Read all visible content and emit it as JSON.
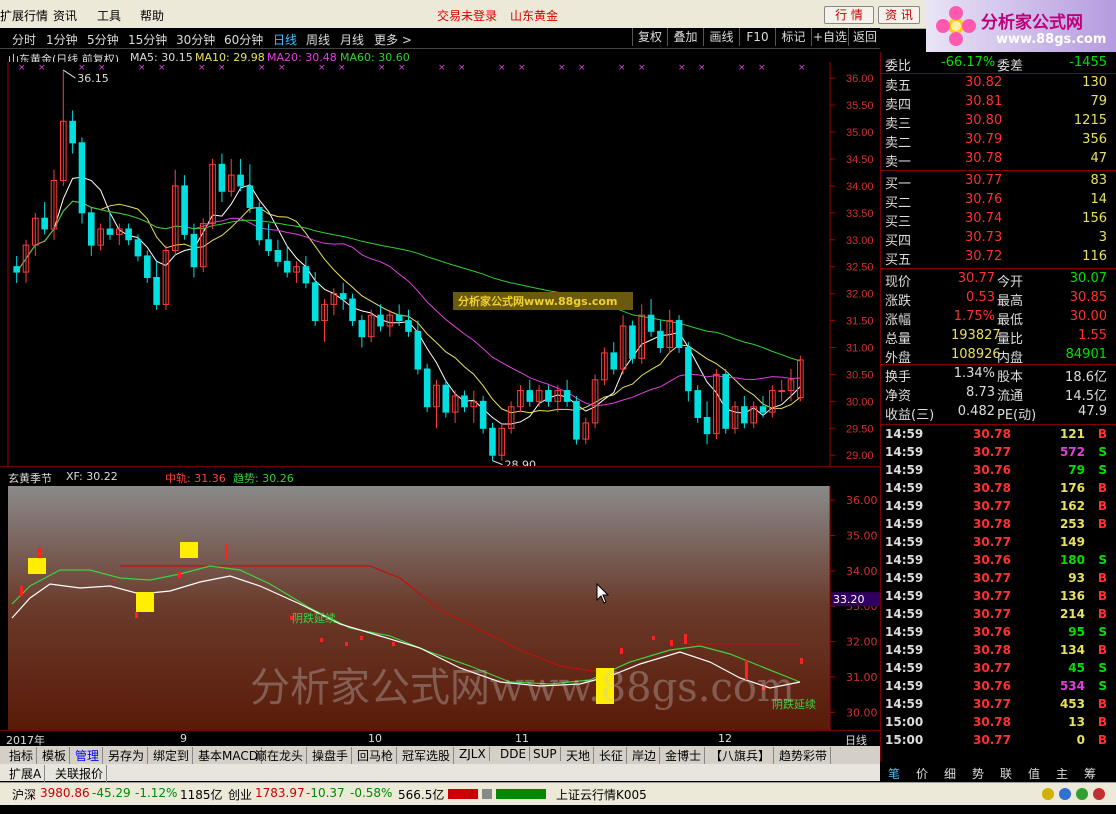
{
  "menu": {
    "items": [
      "扩展行情",
      "资讯",
      "工具",
      "帮助"
    ],
    "status1": "交易未登录",
    "status2": "山东黄金",
    "btn_quote": "行 情",
    "btn_info": "资 讯"
  },
  "logo": {
    "title": "分析家公式网",
    "url": "www.88gs.com"
  },
  "periods": [
    "分时",
    "1分钟",
    "5分钟",
    "15分钟",
    "30分钟",
    "60分钟",
    "日线",
    "周线",
    "月线",
    "更多 >"
  ],
  "active_period": "日线",
  "toolbar": [
    "复权",
    "叠加",
    "画线",
    "F10",
    "标记",
    "+自选",
    "返回"
  ],
  "legend": {
    "name": "山东黄金(日线 前复权)",
    "ma5": "MA5: 30.15",
    "ma10": "MA10: 29.98",
    "ma20": "MA20: 30.48",
    "ma60": "MA60: 30.60",
    "high_label": "36.15",
    "low_label": "28.90",
    "watermark_box": "分析家公式网www.88gs.com"
  },
  "indicator": {
    "name": "玄黄季节",
    "xf": "XF: 30.22",
    "zg": "中轨: 31.36",
    "qs": "趋势: 30.26",
    "text1": "阴跌延续",
    "text2": "阴跌延续",
    "watermark": "分析家公式网www.88gs.com",
    "price_tag": "33.20"
  },
  "colors": {
    "up": "#ff3c3c",
    "down": "#00e0e0",
    "ma5": "#ffffff",
    "ma10": "#e8e060",
    "ma20": "#e040e0",
    "ma60": "#30d030",
    "accent": "#ff4040"
  },
  "price_axis": [
    "36.00",
    "35.50",
    "35.00",
    "34.50",
    "34.00",
    "33.50",
    "33.00",
    "32.50",
    "32.00",
    "31.50",
    "31.00",
    "30.50",
    "30.00",
    "29.50",
    "29.00"
  ],
  "ind_axis": [
    "36.00",
    "35.00",
    "34.00",
    "33.00",
    "32.00",
    "31.00",
    "30.00"
  ],
  "time_axis": [
    "2017年",
    "9",
    "10",
    "11",
    "12"
  ],
  "time_axis_right": "日线",
  "quote": {
    "wb_label": "委比",
    "wb_val": "-66.17%",
    "wc_label": "委差",
    "wc_val": "-1455",
    "sells": [
      {
        "l": "卖五",
        "p": "30.82",
        "v": "130"
      },
      {
        "l": "卖四",
        "p": "30.81",
        "v": "79"
      },
      {
        "l": "卖三",
        "p": "30.80",
        "v": "1215"
      },
      {
        "l": "卖二",
        "p": "30.79",
        "v": "356"
      },
      {
        "l": "卖一",
        "p": "30.78",
        "v": "47"
      }
    ],
    "buys": [
      {
        "l": "买一",
        "p": "30.77",
        "v": "83"
      },
      {
        "l": "买二",
        "p": "30.76",
        "v": "14"
      },
      {
        "l": "买三",
        "p": "30.74",
        "v": "156"
      },
      {
        "l": "买四",
        "p": "30.73",
        "v": "3"
      },
      {
        "l": "买五",
        "p": "30.72",
        "v": "116"
      }
    ],
    "stats": [
      {
        "l1": "现价",
        "v1": "30.77",
        "l2": "今开",
        "v2": "30.07"
      },
      {
        "l1": "涨跌",
        "v1": "0.53",
        "l2": "最高",
        "v2": "30.85"
      },
      {
        "l1": "涨幅",
        "v1": "1.75%",
        "l2": "最低",
        "v2": "30.00"
      },
      {
        "l1": "总量",
        "v1": "193827",
        "l2": "量比",
        "v2": "1.55"
      },
      {
        "l1": "外盘",
        "v1": "108926",
        "l2": "内盘",
        "v2": "84901"
      },
      {
        "l1": "换手",
        "v1": "1.34%",
        "l2": "股本",
        "v2": "18.6亿"
      },
      {
        "l1": "净资",
        "v1": "8.73",
        "l2": "流通",
        "v2": "14.5亿"
      },
      {
        "l1": "收益(三)",
        "v1": "0.482",
        "l2": "PE(动)",
        "v2": "47.9"
      }
    ],
    "ticks": [
      {
        "t": "14:59",
        "p": "30.78",
        "v": "121",
        "s": "B"
      },
      {
        "t": "14:59",
        "p": "30.77",
        "v": "572",
        "s": "S"
      },
      {
        "t": "14:59",
        "p": "30.76",
        "v": "79",
        "s": "S"
      },
      {
        "t": "14:59",
        "p": "30.78",
        "v": "176",
        "s": "B"
      },
      {
        "t": "14:59",
        "p": "30.77",
        "v": "162",
        "s": "B"
      },
      {
        "t": "14:59",
        "p": "30.78",
        "v": "253",
        "s": "B"
      },
      {
        "t": "14:59",
        "p": "30.77",
        "v": "149",
        "s": ""
      },
      {
        "t": "14:59",
        "p": "30.76",
        "v": "180",
        "s": "S"
      },
      {
        "t": "14:59",
        "p": "30.77",
        "v": "93",
        "s": "B"
      },
      {
        "t": "14:59",
        "p": "30.77",
        "v": "136",
        "s": "B"
      },
      {
        "t": "14:59",
        "p": "30.77",
        "v": "214",
        "s": "B"
      },
      {
        "t": "14:59",
        "p": "30.76",
        "v": "95",
        "s": "S"
      },
      {
        "t": "14:59",
        "p": "30.78",
        "v": "134",
        "s": "B"
      },
      {
        "t": "14:59",
        "p": "30.77",
        "v": "45",
        "s": "S"
      },
      {
        "t": "14:59",
        "p": "30.76",
        "v": "534",
        "s": "S"
      },
      {
        "t": "14:59",
        "p": "30.77",
        "v": "453",
        "s": "B"
      },
      {
        "t": "15:00",
        "p": "30.78",
        "v": "13",
        "s": "B"
      },
      {
        "t": "15:00",
        "p": "30.77",
        "v": "0",
        "s": "B"
      }
    ]
  },
  "right_tabs": [
    "笔",
    "价",
    "细",
    "势",
    "联",
    "值",
    "主",
    "筹"
  ],
  "bottom_tabs": [
    "指标",
    "模板",
    "管理",
    "另存为",
    "绑定到",
    "基本MACD",
    "巅在龙头",
    "操盘手",
    "回马枪",
    "冠军选股",
    "ZJLX",
    "DDE",
    "SUP",
    "天地",
    "长征",
    "岸边",
    "金博士",
    "【八旗兵】",
    "趋势彩带"
  ],
  "bottom_tabs2": [
    "扩展A",
    "关联报价"
  ],
  "status": {
    "sh_label": "沪深",
    "sh_val": "3980.86",
    "sh_chg": "-45.29",
    "sh_pct": "-1.12%",
    "sh_amt": "1185亿",
    "cy_label": "创业",
    "cy_val": "1783.97",
    "cy_chg": "-10.37",
    "cy_pct": "-0.58%",
    "cy_amt": "566.5亿",
    "feed": "上证云行情K005"
  },
  "chart_data": {
    "type": "candlestick",
    "x": [
      0,
      1,
      2,
      3,
      4,
      5,
      6,
      7,
      8,
      9,
      10,
      11,
      12,
      13,
      14,
      15,
      16,
      17,
      18,
      19,
      20,
      21,
      22,
      23,
      24,
      25,
      26,
      27,
      28,
      29,
      30,
      31,
      32,
      33,
      34,
      35,
      36,
      37,
      38,
      39,
      40,
      41,
      42,
      43,
      44,
      45,
      46,
      47,
      48,
      49,
      50,
      51,
      52,
      53,
      54,
      55,
      56,
      57,
      58,
      59,
      60,
      61,
      62,
      63,
      64,
      65,
      66,
      67,
      68,
      69,
      70,
      71,
      72,
      73,
      74,
      75,
      76,
      77,
      78,
      79,
      80,
      81,
      82,
      83,
      84,
      85,
      86,
      87,
      88,
      89,
      90,
      91,
      92,
      93,
      94,
      95,
      96,
      97,
      98,
      99,
      100,
      101,
      102,
      103,
      104,
      105,
      106,
      107,
      108,
      109,
      110,
      111,
      112,
      113,
      114,
      115,
      116,
      117
    ],
    "series": [
      {
        "values": [
          [
            32.5,
            32.7,
            32.2,
            32.4
          ],
          [
            32.4,
            33.0,
            32.2,
            32.9
          ],
          [
            32.9,
            33.5,
            32.7,
            33.4
          ],
          [
            33.4,
            33.7,
            33.1,
            33.2
          ],
          [
            33.2,
            34.3,
            33.0,
            34.1
          ],
          [
            34.1,
            36.15,
            34.0,
            35.2
          ],
          [
            35.2,
            35.4,
            34.6,
            34.8
          ],
          [
            34.8,
            34.9,
            33.3,
            33.5
          ],
          [
            33.5,
            33.6,
            32.7,
            32.9
          ],
          [
            32.9,
            33.3,
            32.8,
            33.2
          ],
          [
            33.2,
            33.5,
            33.0,
            33.1
          ],
          [
            33.1,
            33.3,
            32.9,
            33.2
          ],
          [
            33.2,
            33.3,
            32.9,
            33.0
          ],
          [
            33.0,
            33.1,
            32.6,
            32.7
          ],
          [
            32.7,
            32.8,
            32.2,
            32.3
          ],
          [
            32.3,
            32.6,
            31.7,
            31.8
          ],
          [
            31.8,
            32.9,
            31.7,
            32.8
          ],
          [
            32.8,
            34.3,
            32.7,
            34.0
          ],
          [
            34.0,
            34.2,
            33.0,
            33.1
          ],
          [
            33.1,
            33.3,
            32.3,
            32.5
          ],
          [
            32.5,
            33.4,
            32.4,
            33.3
          ],
          [
            33.3,
            34.5,
            33.2,
            34.4
          ],
          [
            34.4,
            34.6,
            33.7,
            33.9
          ],
          [
            33.9,
            34.5,
            33.8,
            34.2
          ],
          [
            34.2,
            34.5,
            33.9,
            34.0
          ],
          [
            34.0,
            34.4,
            33.5,
            33.6
          ],
          [
            33.6,
            33.7,
            32.9,
            33.0
          ],
          [
            33.0,
            33.3,
            32.7,
            32.8
          ],
          [
            32.8,
            33.0,
            32.5,
            32.6
          ],
          [
            32.6,
            32.9,
            32.3,
            32.4
          ],
          [
            32.4,
            32.6,
            32.2,
            32.5
          ],
          [
            32.5,
            32.7,
            32.1,
            32.2
          ],
          [
            32.2,
            32.4,
            31.4,
            31.5
          ],
          [
            31.5,
            31.9,
            31.1,
            31.8
          ],
          [
            31.8,
            32.1,
            31.6,
            32.0
          ],
          [
            32.0,
            32.2,
            31.7,
            31.9
          ],
          [
            31.9,
            32.0,
            31.4,
            31.5
          ],
          [
            31.5,
            31.6,
            31.0,
            31.2
          ],
          [
            31.2,
            31.7,
            31.1,
            31.6
          ],
          [
            31.6,
            31.8,
            31.3,
            31.4
          ],
          [
            31.4,
            31.7,
            31.2,
            31.6
          ],
          [
            31.6,
            31.8,
            31.4,
            31.5
          ],
          [
            31.5,
            31.7,
            31.2,
            31.3
          ],
          [
            31.3,
            31.5,
            30.5,
            30.6
          ],
          [
            30.6,
            30.7,
            29.8,
            29.9
          ],
          [
            29.9,
            30.4,
            29.5,
            30.3
          ],
          [
            30.3,
            30.4,
            29.7,
            29.8
          ],
          [
            29.8,
            30.2,
            29.6,
            30.1
          ],
          [
            30.1,
            30.2,
            29.8,
            29.9
          ],
          [
            29.9,
            30.2,
            29.6,
            30.0
          ],
          [
            30.0,
            30.1,
            29.4,
            29.5
          ],
          [
            29.5,
            29.6,
            28.9,
            29.0
          ],
          [
            29.0,
            29.6,
            28.9,
            29.5
          ],
          [
            29.5,
            30.0,
            29.4,
            29.9
          ],
          [
            29.9,
            30.3,
            29.8,
            30.2
          ],
          [
            30.2,
            30.4,
            29.9,
            30.0
          ],
          [
            30.0,
            30.3,
            29.9,
            30.2
          ],
          [
            30.2,
            30.3,
            29.9,
            30.0
          ],
          [
            30.0,
            30.3,
            29.8,
            30.2
          ],
          [
            30.2,
            30.4,
            29.9,
            30.0
          ],
          [
            30.0,
            30.1,
            29.2,
            29.3
          ],
          [
            29.3,
            29.7,
            29.2,
            29.6
          ],
          [
            29.6,
            30.5,
            29.5,
            30.4
          ],
          [
            30.4,
            31.0,
            30.3,
            30.9
          ],
          [
            30.9,
            31.1,
            30.5,
            30.6
          ],
          [
            30.6,
            31.6,
            30.5,
            31.4
          ],
          [
            31.4,
            31.5,
            30.7,
            30.8
          ],
          [
            30.8,
            31.8,
            30.7,
            31.6
          ],
          [
            31.6,
            31.9,
            31.2,
            31.3
          ],
          [
            31.3,
            31.5,
            30.9,
            31.0
          ],
          [
            31.0,
            31.7,
            30.9,
            31.5
          ],
          [
            31.5,
            31.6,
            30.9,
            31.0
          ],
          [
            31.0,
            31.1,
            30.0,
            30.2
          ],
          [
            30.2,
            30.3,
            29.6,
            29.7
          ],
          [
            29.7,
            30.0,
            29.2,
            29.4
          ],
          [
            29.4,
            30.6,
            29.3,
            30.5
          ],
          [
            30.5,
            30.6,
            29.4,
            29.5
          ],
          [
            29.5,
            30.0,
            29.4,
            29.9
          ],
          [
            29.9,
            30.1,
            29.5,
            29.6
          ],
          [
            29.6,
            30.0,
            29.5,
            29.9
          ],
          [
            29.9,
            30.1,
            29.7,
            29.8
          ],
          [
            29.8,
            30.3,
            29.7,
            30.2
          ],
          [
            30.2,
            30.4,
            30.0,
            30.2
          ],
          [
            30.2,
            30.6,
            30.0,
            30.4
          ],
          [
            30.07,
            30.85,
            30.0,
            30.77
          ]
        ]
      }
    ],
    "ylim": [
      28.8,
      36.3
    ]
  }
}
